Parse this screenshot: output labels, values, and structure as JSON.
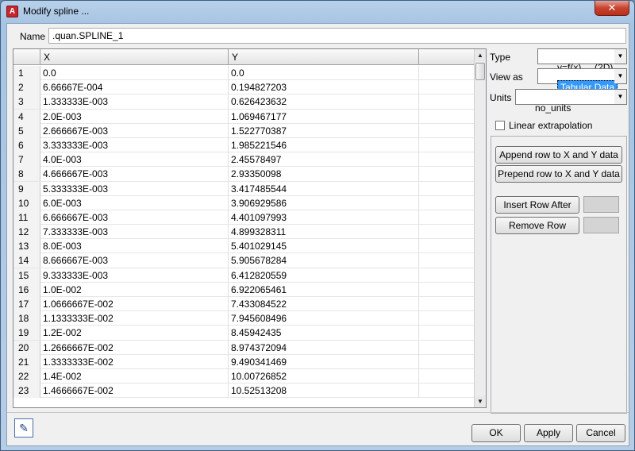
{
  "window": {
    "title": "Modify spline ...",
    "close_label": "✕"
  },
  "name": {
    "label": "Name",
    "value": ".quan.SPLINE_1"
  },
  "grid": {
    "headers": [
      "X",
      "Y"
    ],
    "rows": [
      {
        "n": "1",
        "x": "0.0",
        "y": "0.0"
      },
      {
        "n": "2",
        "x": "6.66667E-004",
        "y": "0.194827203"
      },
      {
        "n": "3",
        "x": "1.333333E-003",
        "y": "0.626423632"
      },
      {
        "n": "4",
        "x": "2.0E-003",
        "y": "1.069467177"
      },
      {
        "n": "5",
        "x": "2.666667E-003",
        "y": "1.522770387"
      },
      {
        "n": "6",
        "x": "3.333333E-003",
        "y": "1.985221546"
      },
      {
        "n": "7",
        "x": "4.0E-003",
        "y": "2.45578497"
      },
      {
        "n": "8",
        "x": "4.666667E-003",
        "y": "2.93350098"
      },
      {
        "n": "9",
        "x": "5.333333E-003",
        "y": "3.417485544"
      },
      {
        "n": "10",
        "x": "6.0E-003",
        "y": "3.906929586"
      },
      {
        "n": "11",
        "x": "6.666667E-003",
        "y": "4.401097993"
      },
      {
        "n": "12",
        "x": "7.333333E-003",
        "y": "4.899328311"
      },
      {
        "n": "13",
        "x": "8.0E-003",
        "y": "5.401029145"
      },
      {
        "n": "14",
        "x": "8.666667E-003",
        "y": "5.905678284"
      },
      {
        "n": "15",
        "x": "9.333333E-003",
        "y": "6.412820559"
      },
      {
        "n": "16",
        "x": "1.0E-002",
        "y": "6.922065461"
      },
      {
        "n": "17",
        "x": "1.0666667E-002",
        "y": "7.433084522"
      },
      {
        "n": "18",
        "x": "1.1333333E-002",
        "y": "7.945608496"
      },
      {
        "n": "19",
        "x": "1.2E-002",
        "y": "8.45942435"
      },
      {
        "n": "20",
        "x": "1.2666667E-002",
        "y": "8.974372094"
      },
      {
        "n": "21",
        "x": "1.3333333E-002",
        "y": "9.490341469"
      },
      {
        "n": "22",
        "x": "1.4E-002",
        "y": "10.00726852"
      },
      {
        "n": "23",
        "x": "1.4666667E-002",
        "y": "10.52513208"
      }
    ]
  },
  "side": {
    "type_label": "Type",
    "type_value": "y=f(x)     (2D)",
    "viewas_label": "View as",
    "viewas_value": "Tabular Data",
    "units_label": "Units",
    "units_value": "no_units",
    "linear_label": "Linear extrapolation",
    "append_label": "Append row to X and Y data",
    "prepend_label": "Prepend row to X and Y data",
    "insert_label": "Insert Row After",
    "remove_label": "Remove Row"
  },
  "footer": {
    "ok": "OK",
    "apply": "Apply",
    "cancel": "Cancel"
  },
  "icons": {
    "app": "autocad-red-icon",
    "close": "close-icon",
    "dropdown": "chevron-down-icon",
    "tool": "pencil-table-icon"
  }
}
